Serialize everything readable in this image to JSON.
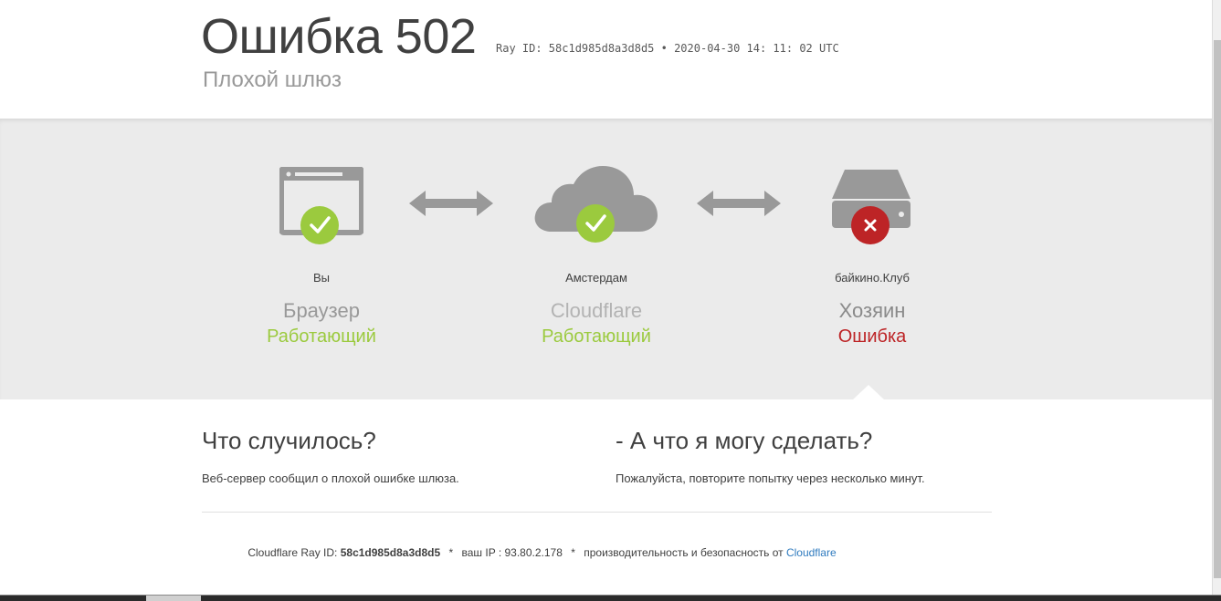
{
  "header": {
    "title_word": "Ошибка",
    "title_code": "502",
    "ray_line": "Ray ID: 58c1d985d8a3d8d5 • 2020-04-30 14: 11: 02 UTC",
    "subtitle": "Плохой шлюз"
  },
  "status": [
    {
      "place": "Вы",
      "role": "Браузер",
      "state": "Работающий",
      "state_kind": "ok",
      "icon": "browser-icon"
    },
    {
      "place": "Амстердам",
      "role": "Cloudflare",
      "state": "Работающий",
      "state_kind": "ok",
      "icon": "cloud-icon"
    },
    {
      "place": "байкино.Клуб",
      "role": "Хозяин",
      "state": "Ошибка",
      "state_kind": "error",
      "icon": "server-icon"
    }
  ],
  "info": {
    "what_happened_title": "Что случилось?",
    "what_happened_text": "Веб-сервер сообщил о плохой ошибке шлюза.",
    "what_can_i_do_title": "- А что я могу сделать?",
    "what_can_i_do_text": "Пожалуйста, повторите попытку через несколько минут."
  },
  "footer": {
    "ray_label": "Cloudflare Ray ID:",
    "ray_id": "58c1d985d8a3d8d5",
    "sep": "*",
    "ip_label": "ваш IP : 93.80.2.178",
    "perf_label": "производительность и безопасность от",
    "cloudflare_link": "Cloudflare"
  },
  "colors": {
    "ok": "#9bca3e",
    "error": "#bd2426",
    "link": "#2f7bbf",
    "icon_gray": "#999999",
    "band": "#ebebeb"
  }
}
